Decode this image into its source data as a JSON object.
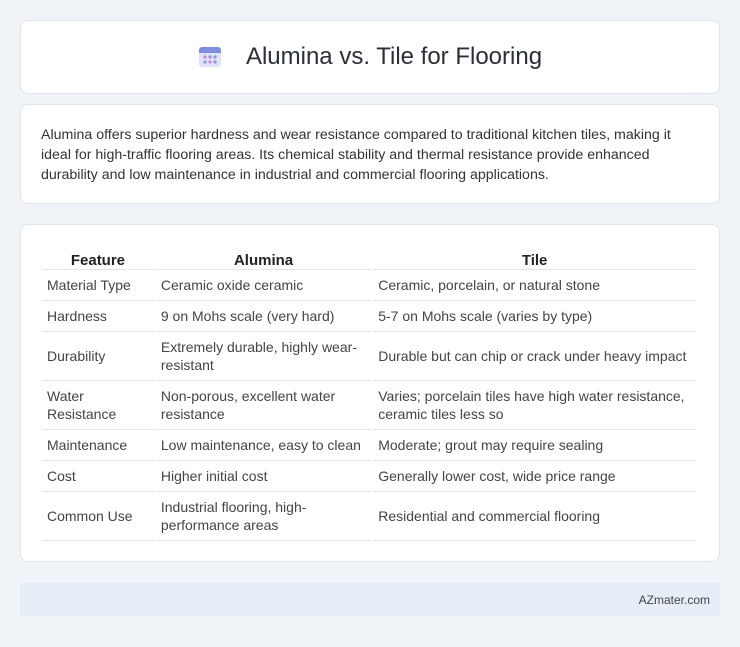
{
  "header": {
    "title": "Alumina vs. Tile for Flooring",
    "icon": "calendar-icon"
  },
  "intro": {
    "text": "Alumina offers superior hardness and wear resistance compared to traditional kitchen tiles, making it ideal for high-traffic flooring areas. Its chemical stability and thermal resistance provide enhanced durability and low maintenance in industrial and commercial flooring applications."
  },
  "table": {
    "headers": [
      "Feature",
      "Alumina",
      "Tile"
    ],
    "rows": [
      [
        "Material Type",
        "Ceramic oxide ceramic",
        "Ceramic, porcelain, or natural stone"
      ],
      [
        "Hardness",
        "9 on Mohs scale (very hard)",
        "5-7 on Mohs scale (varies by type)"
      ],
      [
        "Durability",
        "Extremely durable, highly wear-resistant",
        "Durable but can chip or crack under heavy impact"
      ],
      [
        "Water Resistance",
        "Non-porous, excellent water resistance",
        "Varies; porcelain tiles have high water resistance, ceramic tiles less so"
      ],
      [
        "Maintenance",
        "Low maintenance, easy to clean",
        "Moderate; grout may require sealing"
      ],
      [
        "Cost",
        "Higher initial cost",
        "Generally lower cost, wide price range"
      ],
      [
        "Common Use",
        "Industrial flooring, high-performance areas",
        "Residential and commercial flooring"
      ]
    ]
  },
  "footer": {
    "site": "AZmater.com"
  },
  "colors": {
    "background": "#f0f3f8",
    "footer_bg": "#e6edf7",
    "icon_accent": "#8a7fd6"
  }
}
